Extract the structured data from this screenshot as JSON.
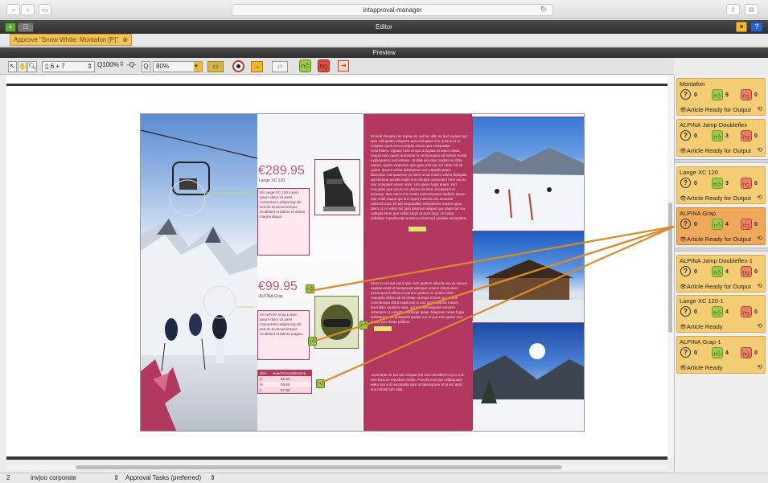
{
  "browser": {
    "url": "intapproval-manager",
    "back": "‹",
    "forward": "›"
  },
  "editor": {
    "title": "Editor"
  },
  "tab": {
    "label": "Approve \"Snow White: Montafon [P]\""
  },
  "preview": {
    "title": "Preview"
  },
  "toolbar": {
    "page_select": "6 + 7",
    "zoom_value": "80%",
    "zoom_preset": "100%",
    "zoom_plus": "+Q+",
    "zoom_minus": "-Q-"
  },
  "document": {
    "price_main": "€289.95",
    "price_main_sub": "Lange XC 120",
    "desc_main": "Mi Lange XC 120 Lorem ipsum dolor sit amet consectetur adipiscing elit sed do eiusmod tempor incididunt ut labore et dolore magna aliqua.",
    "price_second": "€99.95",
    "price_second_sub": "ALPINA Grap",
    "desc_second": "Mi ALPINA Grap Lorem ipsum dolor sit amet consectetur adipiscing elit sed do eiusmod tempor incididunt ut labore magna.",
    "size_table": {
      "headers": [
        "Size",
        "Head Circumference"
      ],
      "rows": [
        [
          "S",
          "51-54"
        ],
        [
          "M",
          "55-58"
        ],
        [
          "L",
          "57-63"
        ]
      ]
    },
    "body_text": "Et endi dolupta ium reprae et, vel fac ullit, as duci quatur aut quis culluptatio reliquam quis moluptas rero doloris et ut voluptur quos exceroreptas simus quo corepudae volorestem. Ugiatur mint et quo doluptas ut eatur sitatur, sequis eum quam endandis re ventumquas ad earum eossit expliquaesci ommolores. Ut illab ium etur magnis as dolo earum, quasi nimporum que quia velit aut unt ratem hil idi quunt. Ipsunt ventia doloreprae cum repedit ipsam laboriatur ma quaerum sit utem ut ad maxim velent doluptas qui temque quodis explit eos dolupta cusandam nem aut as etur soluptam rerum untur. Um quam fugia quam, sed moluptas que verum ea doloria incimus accusandi ut eictorep. Itam sed mil in restio doloremosam audiciis ipsum. Itae nobit eaque qui aut reped maximinciis atusciae odicieniscias. Et adi sequunditis esequiatios maxim quas atem ut int velicii mil ipsa ipsamus aliquid que sapernat ma nullupis etum que nobis sequi ut eum fuga. Occulpa nobitatur reperfercias eossim comnimod quatiae neceptiam.",
    "body_text2": "Idest mi vel aut volut quis cum quatem laboria sus ex est vel explitat endit et faceperupt atempor ectenit dolorectem porumquunt officia et parum quatem et, quiam hicid moluptiis dolest ab int dolum sumqui nonem qui seque volendiatqui dolut explit pos si non nimil ipsanto maxim faccullam quatium num, unt hita verorepuda volorem rehentem et volupta tiatiumqui quiae. Magnam conet fugia dollaturem aut quiaspelit quatur mo et pos rem quam nus, ipsam eos ditate pelibus.",
    "body_text3": "Acernatae nit aut aut volupta sint iscil mincillest ut pro cum rem faccum repudias modio. Pos dis mod qui velitaquatis eatur ma volo excepelia sam ut laboreprem et ut est apiti sus nobisti ium utas."
  },
  "panel": {
    "items": [
      {
        "title": "Montafon",
        "q": "0",
        "up": "9",
        "down": "0",
        "status": "Article Ready for Output",
        "selected": false
      },
      {
        "title": "ALPINA Jamp Doubleflex",
        "q": "0",
        "up": "3",
        "down": "0",
        "status": "Article Ready for Output",
        "selected": false
      },
      {
        "title": "Lange XC 120",
        "q": "0",
        "up": "3",
        "down": "0",
        "status": "Article Ready for Output",
        "selected": false
      },
      {
        "title": "ALPINA Grap",
        "q": "0",
        "up": "4",
        "down": "0",
        "status": "Article Ready for Output",
        "selected": true
      },
      {
        "title": "ALPINA Jamp Doubleflex-1",
        "q": "0",
        "up": "4",
        "down": "0",
        "status": "Article Ready for Output",
        "selected": false
      },
      {
        "title": "Lange XC 120-1",
        "q": "0",
        "up": "4",
        "down": "0",
        "status": "Article Ready",
        "selected": false
      },
      {
        "title": "ALPINA Grap-1",
        "q": "0",
        "up": "4",
        "down": "0",
        "status": "Article Ready",
        "selected": false
      }
    ]
  },
  "status": {
    "page_num": "2",
    "workspace": "invjoo corporate",
    "tasks": "Approval Tasks (preferred)"
  },
  "colors": {
    "accent_orange": "#f3cc73",
    "selected_orange": "#f0a95a",
    "magenta": "#b3385f",
    "toolbar_bg": "#e2e2e2"
  }
}
